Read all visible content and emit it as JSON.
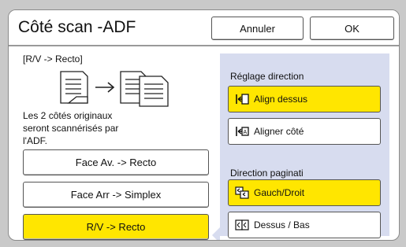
{
  "header": {
    "title": "Côté scan -ADF",
    "cancel_label": "Annuler",
    "ok_label": "OK"
  },
  "left": {
    "mode_label": "[R/V -> Recto]",
    "description_line1": "Les 2 côtés originaux",
    "description_line2": "seront scannérisés par",
    "description_line3": "l'ADF.",
    "options": [
      {
        "label": "Face Av. -> Recto",
        "selected": false
      },
      {
        "label": "Face Arr -> Simplex",
        "selected": false
      },
      {
        "label": "R/V -> Recto",
        "selected": true
      }
    ]
  },
  "right": {
    "direction_heading": "Réglage direction",
    "direction_options": [
      {
        "label": "Align dessus",
        "icon": "align-top-icon",
        "selected": true
      },
      {
        "label": "Aligner côté",
        "icon": "align-side-icon",
        "selected": false
      }
    ],
    "pagination_heading": "Direction paginati",
    "pagination_options": [
      {
        "label": "Gauch/Droit",
        "icon": "left-right-pages-icon",
        "selected": true
      },
      {
        "label": "Dessus / Bas",
        "icon": "top-bottom-pages-icon",
        "selected": false
      }
    ]
  },
  "colors": {
    "selected": "#ffe600",
    "panel": "#d7dcef",
    "background": "#c9c9c9"
  }
}
